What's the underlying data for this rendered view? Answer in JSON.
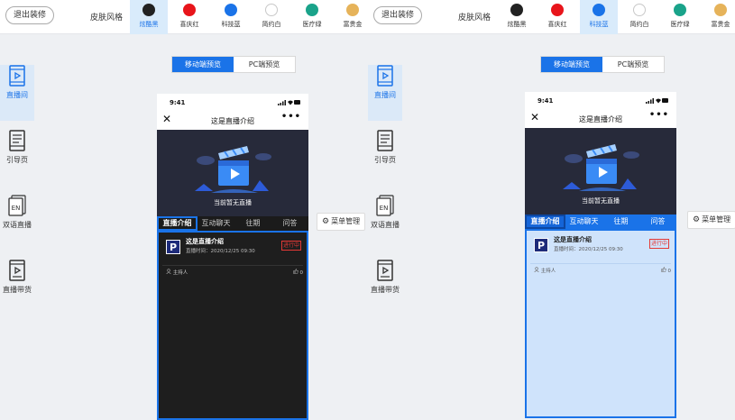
{
  "exit_label": "退出装修",
  "skin_label": "皮肤风格",
  "skins": [
    {
      "name": "炫酷黑",
      "color": "#222222"
    },
    {
      "name": "喜庆红",
      "color": "#e8151b"
    },
    {
      "name": "科技蓝",
      "color": "#1a73e8"
    },
    {
      "name": "简约白",
      "color": "#ffffff"
    },
    {
      "name": "医疗绿",
      "color": "#1aa38a"
    },
    {
      "name": "富贵金",
      "color": "#e6b35a"
    }
  ],
  "sidebar": [
    {
      "label": "直播间",
      "icon": "play-box-icon"
    },
    {
      "label": "引导页",
      "icon": "guide-page-icon"
    },
    {
      "label": "双语直播",
      "icon": "en-icon"
    },
    {
      "label": "直播带货",
      "icon": "shopping-play-icon"
    }
  ],
  "en_glyph": "EN",
  "view_toggle": {
    "mobile": "移动端预览",
    "pc": "PC端预览"
  },
  "phone": {
    "time": "9:41",
    "close_glyph": "✕",
    "title": "这是直播介绍",
    "more_glyph": "•••",
    "no_live": "当前暂无直播",
    "tabs": [
      "直播介绍",
      "互动聊天",
      "往期",
      "问答"
    ],
    "logo_letter": "P",
    "info_title": "这是直播介绍",
    "info_time": "直播时间：2020/12/25 09:30",
    "badge": "进行中",
    "host": "主持人",
    "likes": "0"
  },
  "menu_manage": "菜单管理",
  "panels": [
    {
      "active_skin": "炫酷黑"
    },
    {
      "active_skin": "科技蓝"
    }
  ]
}
